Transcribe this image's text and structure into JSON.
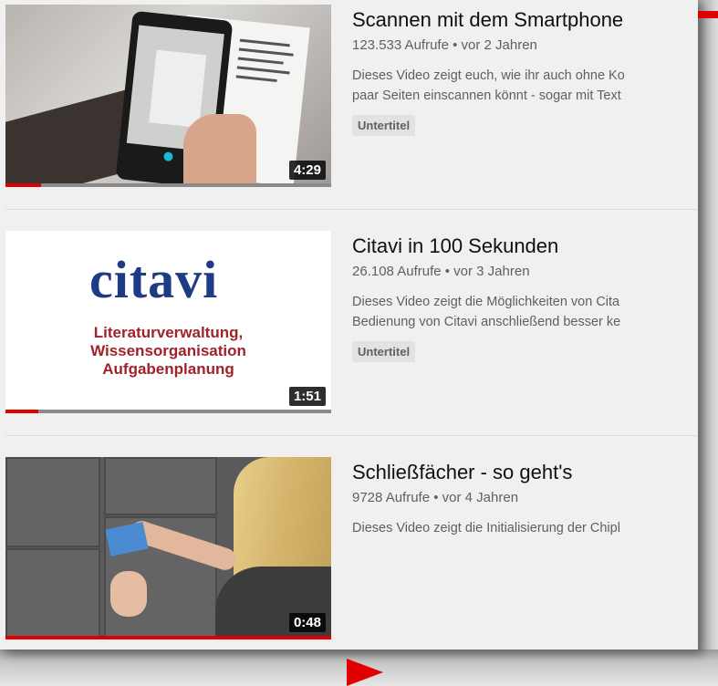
{
  "videos": [
    {
      "title": "Scannen mit dem Smartphone",
      "meta": "123.533 Aufrufe • vor 2 Jahren",
      "desc_line1": "Dieses Video zeigt euch, wie ihr auch ohne Ko",
      "desc_line2": "paar Seiten einscannen könnt - sogar mit Text",
      "badge": "Untertitel",
      "duration": "4:29",
      "progress": 0.11
    },
    {
      "title": "Citavi in 100 Sekunden",
      "meta": "26.108 Aufrufe • vor 3 Jahren",
      "desc_line1": "Dieses Video zeigt die Möglichkeiten von Cita",
      "desc_line2": "Bedienung von Citavi anschließend besser ke",
      "badge": "Untertitel",
      "duration": "1:51",
      "progress": 0.1,
      "thumb_logo": "citavi",
      "thumb_lines": [
        "Literaturverwaltung,",
        "Wissensorganisation",
        "Aufgabenplanung"
      ]
    },
    {
      "title": "Schließfächer - so geht's",
      "meta": "9728 Aufrufe • vor 4 Jahren",
      "desc_line1": "Dieses Video zeigt die Initialisierung der Chipl",
      "duration": "0:48",
      "progress": 1.0
    }
  ],
  "colors": {
    "accent": "#e00000",
    "citavi_blue": "#1e3c86",
    "citavi_red": "#a0222a"
  }
}
